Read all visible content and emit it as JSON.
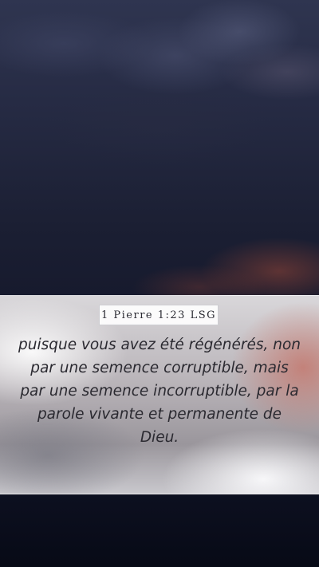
{
  "verse": {
    "reference": "1 Pierre 1:23 LSG",
    "text": "puisque vous avez été régénérés, non par une semence corruptible, mais par une semence incorruptible, par la parole vivante et permanente de Dieu."
  },
  "colors": {
    "sky_top": "#2f3550",
    "sky_bottom": "#121427",
    "sunset_glow": "#963f37",
    "panel": "#c4c0c4",
    "text": "#2a2930"
  }
}
